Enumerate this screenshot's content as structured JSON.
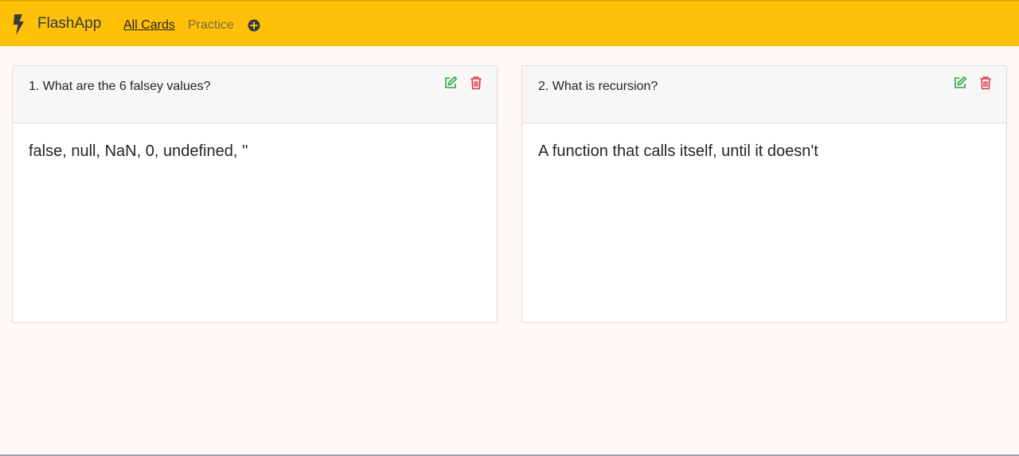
{
  "navbar": {
    "brand": "FlashApp",
    "brand_icon": "bolt-icon",
    "links": [
      {
        "label": "All Cards",
        "active": true
      },
      {
        "label": "Practice",
        "active": false
      }
    ],
    "add_icon": "plus-circle-icon",
    "background": "#ffc107"
  },
  "cards": [
    {
      "question": "1. What are the 6 falsey values?",
      "answer": "false, null, NaN, 0, undefined, ''",
      "edit_icon": "edit-icon",
      "delete_icon": "trash-icon"
    },
    {
      "question": "2. What is recursion?",
      "answer": "A function that calls itself, until it doesn't",
      "edit_icon": "edit-icon",
      "delete_icon": "trash-icon"
    }
  ],
  "colors": {
    "edit": "#28a745",
    "delete": "#dc3545",
    "page_background": "#fff9f5"
  }
}
